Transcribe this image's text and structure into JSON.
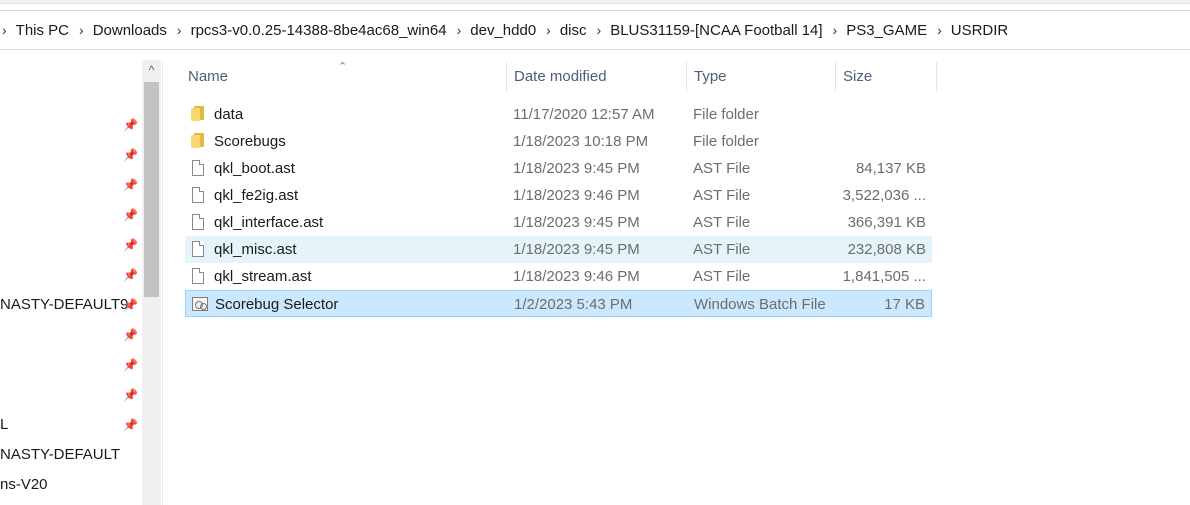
{
  "breadcrumb": {
    "items": [
      "This PC",
      "Downloads",
      "rpcs3-v0.0.25-14388-8be4ac68_win64",
      "dev_hdd0",
      "disc",
      "BLUS31159-[NCAA Football 14]",
      "PS3_GAME",
      "USRDIR"
    ],
    "separator": "›"
  },
  "nav": {
    "scroll_up_glyph": "^",
    "items": [
      {
        "label": "",
        "pinned": true
      },
      {
        "label": "",
        "pinned": true
      },
      {
        "label": "",
        "pinned": true
      },
      {
        "label": "",
        "pinned": true
      },
      {
        "label": "",
        "pinned": true
      },
      {
        "label": "",
        "pinned": true
      },
      {
        "label": "NASTY-DEFAULT9",
        "pinned": true
      },
      {
        "label": "",
        "pinned": true
      },
      {
        "label": "",
        "pinned": true
      },
      {
        "label": "",
        "pinned": true
      },
      {
        "label": "L",
        "pinned": true
      },
      {
        "label": "NASTY-DEFAULT",
        "pinned": false
      },
      {
        "label": "ns-V20",
        "pinned": false
      }
    ]
  },
  "columns": {
    "name": "Name",
    "date": "Date modified",
    "type": "Type",
    "size": "Size"
  },
  "files": [
    {
      "name": "data",
      "date": "11/17/2020 12:57 AM",
      "type": "File folder",
      "size": "",
      "icon": "folder-icon",
      "state": "normal"
    },
    {
      "name": "Scorebugs",
      "date": "1/18/2023 10:18 PM",
      "type": "File folder",
      "size": "",
      "icon": "folder-icon",
      "state": "normal"
    },
    {
      "name": "qkl_boot.ast",
      "date": "1/18/2023 9:45 PM",
      "type": "AST File",
      "size": "84,137 KB",
      "icon": "file-icon",
      "state": "normal"
    },
    {
      "name": "qkl_fe2ig.ast",
      "date": "1/18/2023 9:46 PM",
      "type": "AST File",
      "size": "3,522,036 ...",
      "icon": "file-icon",
      "state": "normal"
    },
    {
      "name": "qkl_interface.ast",
      "date": "1/18/2023 9:45 PM",
      "type": "AST File",
      "size": "366,391 KB",
      "icon": "file-icon",
      "state": "normal"
    },
    {
      "name": "qkl_misc.ast",
      "date": "1/18/2023 9:45 PM",
      "type": "AST File",
      "size": "232,808 KB",
      "icon": "file-icon",
      "state": "hover"
    },
    {
      "name": "qkl_stream.ast",
      "date": "1/18/2023 9:46 PM",
      "type": "AST File",
      "size": "1,841,505 ...",
      "icon": "file-icon",
      "state": "normal"
    },
    {
      "name": "Scorebug Selector",
      "date": "1/2/2023 5:43 PM",
      "type": "Windows Batch File",
      "size": "17 KB",
      "icon": "batch-file-icon",
      "state": "selected"
    }
  ]
}
